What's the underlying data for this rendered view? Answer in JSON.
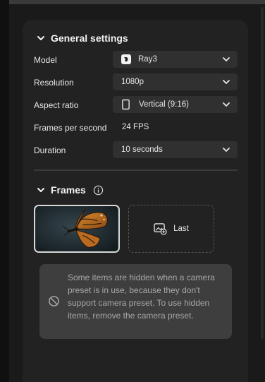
{
  "general": {
    "title": "General settings",
    "rows": {
      "model": {
        "label": "Model",
        "value": "Ray3"
      },
      "resolution": {
        "label": "Resolution",
        "value": "1080p"
      },
      "aspect": {
        "label": "Aspect ratio",
        "value": "Vertical (9:16)"
      },
      "fps": {
        "label": "Frames per second",
        "value": "24 FPS"
      },
      "duration": {
        "label": "Duration",
        "value": "10 seconds"
      }
    }
  },
  "frames": {
    "title": "Frames",
    "last_label": "Last"
  },
  "notice": {
    "text": "Some items are hidden when a camera preset is in use, because they don't support camera preset. To use hidden items, remove the camera preset."
  },
  "icons": {
    "model_logo": "ray-logo-icon",
    "aspect": "vertical-rectangle-icon",
    "info": "info-icon",
    "add_image": "add-image-icon",
    "blocked": "blocked-icon"
  },
  "colors": {
    "panel": "#222222",
    "dropdown": "#303030",
    "notice_bg": "#3e3e3e",
    "notice_text": "#a8a8a8"
  }
}
